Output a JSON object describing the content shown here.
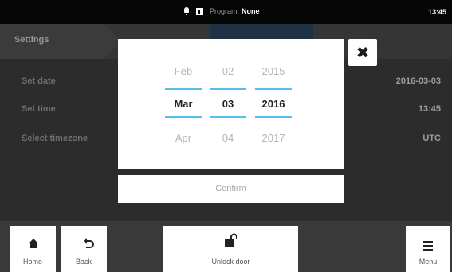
{
  "status_bar": {
    "program_label": "Program:",
    "program_value": "None",
    "time": "13:45",
    "icons": [
      "bell-icon",
      "card-icon"
    ]
  },
  "breadcrumb": {
    "item1": "Settings"
  },
  "settings": {
    "rows": [
      {
        "label": "Set date",
        "value": "2016-03-03"
      },
      {
        "label": "Set time",
        "value": "13:45"
      },
      {
        "label": "Select timezone",
        "value": "UTC"
      }
    ]
  },
  "date_picker": {
    "month": {
      "prev": "Feb",
      "selected": "Mar",
      "next": "Apr"
    },
    "day": {
      "prev": "02",
      "selected": "03",
      "next": "04"
    },
    "year": {
      "prev": "2015",
      "selected": "2016",
      "next": "2017"
    },
    "accent_color": "#54c1ec"
  },
  "dialog": {
    "close_icon": "close-icon",
    "confirm_label": "Confirm"
  },
  "bottom_bar": {
    "home_label": "Home",
    "back_label": "Back",
    "unlock_label": "Unlock door",
    "menu_label": "Menu"
  }
}
